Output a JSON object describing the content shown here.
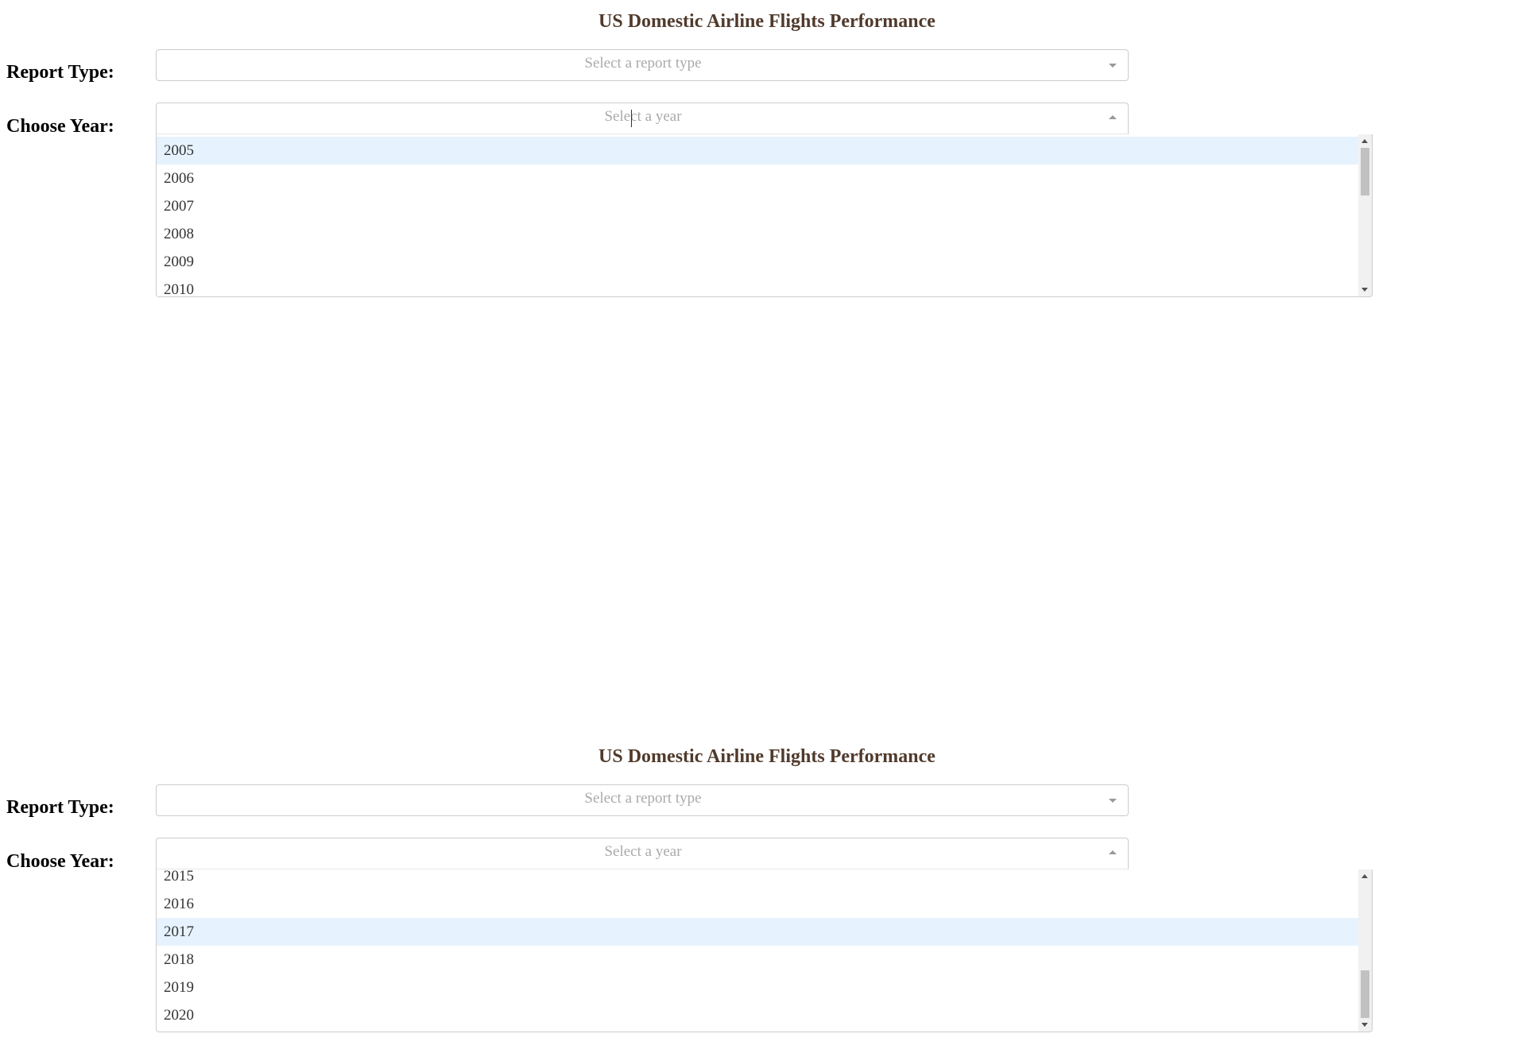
{
  "panels": [
    {
      "title": "US Domestic Airline Flights Performance",
      "report_label": "Report Type:",
      "report_placeholder": "Select a report type",
      "year_label": "Choose Year:",
      "year_placeholder": "Select a year",
      "year_options": [
        "2005",
        "2006",
        "2007",
        "2008",
        "2009",
        "2010"
      ],
      "focused_option": "2005"
    },
    {
      "title": "US Domestic Airline Flights Performance",
      "report_label": "Report Type:",
      "report_placeholder": "Select a report type",
      "year_label": "Choose Year:",
      "year_placeholder": "Select a year",
      "year_options": [
        "2015",
        "2016",
        "2017",
        "2018",
        "2019",
        "2020"
      ],
      "focused_option": "2017"
    }
  ],
  "colors": {
    "title": "#503a2c",
    "focused_option_bg": "#e6f3fe",
    "placeholder": "#aaaaaa"
  }
}
